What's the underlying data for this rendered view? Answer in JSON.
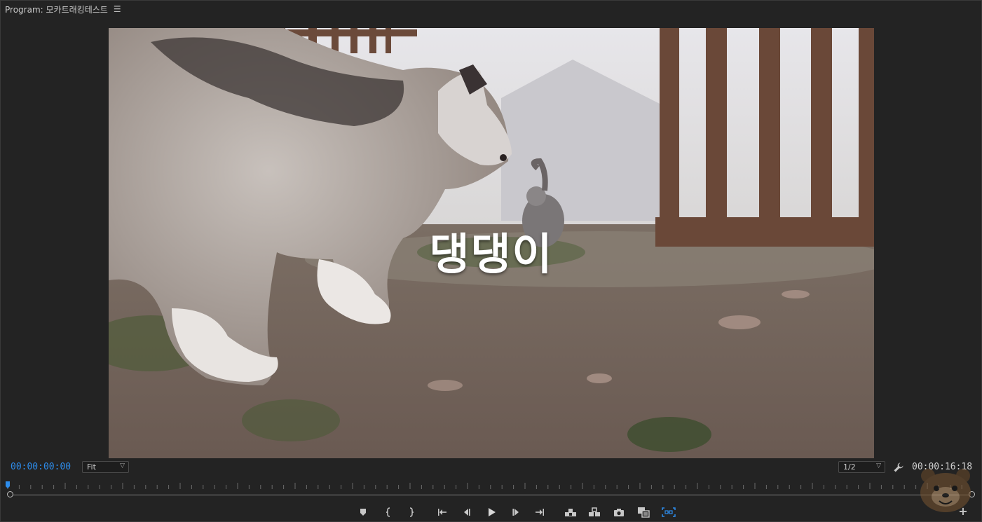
{
  "header": {
    "panel_title": "Program: 모카트래킹테스트",
    "menu_icon": "hamburger-menu-icon"
  },
  "viewer": {
    "title_text": "댕댕이"
  },
  "timebar": {
    "current_timecode": "00:00:00:00",
    "duration_timecode": "00:00:16:18",
    "zoom_value": "Fit",
    "resolution_value": "1/2"
  },
  "controls": [
    {
      "name": "add-marker-button",
      "icon": "marker-icon"
    },
    {
      "name": "mark-in-button",
      "icon": "mark-in-icon"
    },
    {
      "name": "mark-out-button",
      "icon": "mark-out-icon"
    },
    {
      "name": "go-to-in-button",
      "icon": "go-to-in-icon"
    },
    {
      "name": "step-back-button",
      "icon": "step-back-icon"
    },
    {
      "name": "play-button",
      "icon": "play-icon"
    },
    {
      "name": "step-forward-button",
      "icon": "step-forward-icon"
    },
    {
      "name": "go-to-out-button",
      "icon": "go-to-out-icon"
    },
    {
      "name": "lift-button",
      "icon": "lift-icon"
    },
    {
      "name": "extract-button",
      "icon": "extract-icon"
    },
    {
      "name": "export-frame-button",
      "icon": "camera-icon"
    },
    {
      "name": "comparison-view-button",
      "icon": "comparison-view-icon"
    },
    {
      "name": "proxy-toggle-button",
      "icon": "proxy-icon"
    }
  ],
  "colors": {
    "accent": "#2d8ceb",
    "panel_bg": "#232323"
  }
}
